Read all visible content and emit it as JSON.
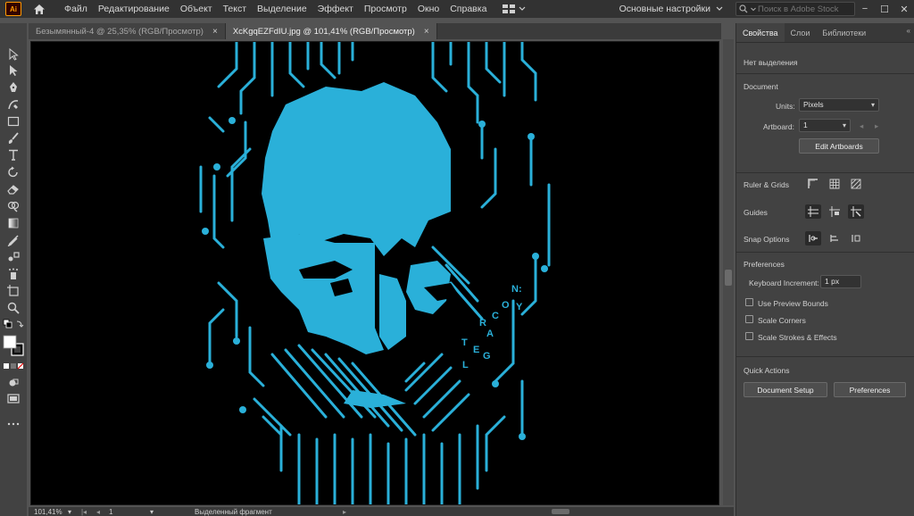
{
  "app": {
    "logo_text": "Ai",
    "menus": [
      "Файл",
      "Редактирование",
      "Объект",
      "Текст",
      "Выделение",
      "Эффект",
      "Просмотр",
      "Окно",
      "Справка"
    ],
    "workspace_label": "Основные настройки",
    "stock_search_placeholder": "Поиск в Adobe Stock",
    "window_controls": [
      "−",
      "☐",
      "✕"
    ]
  },
  "tabs": [
    {
      "label": "Безымянный-4 @ 25,35% (RGB/Просмотр)",
      "close": "×",
      "active": false
    },
    {
      "label": "XcKgqEZFdIU.jpg @ 101,41% (RGB/Просмотр)",
      "close": "×",
      "active": true
    }
  ],
  "artwork_letters": [
    "N:",
    "O",
    "C",
    "Y",
    "R",
    "A",
    "T",
    "E",
    "G",
    "L"
  ],
  "status": {
    "zoom": "101,41%",
    "artboard": "1",
    "state": "Выделенный фрагмент"
  },
  "panel": {
    "tabs": [
      "Свойства",
      "Слои",
      "Библиотеки"
    ],
    "no_selection": "Нет выделения",
    "document_title": "Document",
    "units_label": "Units:",
    "units_value": "Pixels",
    "artboard_label": "Artboard:",
    "artboard_value": "1",
    "edit_artboards": "Edit Artboards",
    "ruler_grids": "Ruler & Grids",
    "guides": "Guides",
    "snap_options": "Snap Options",
    "preferences_title": "Preferences",
    "keyboard_increment_label": "Keyboard Increment:",
    "keyboard_increment_value": "1 px",
    "use_preview_bounds": "Use Preview Bounds",
    "scale_corners": "Scale Corners",
    "scale_strokes": "Scale Strokes & Effects",
    "quick_actions": "Quick Actions",
    "document_setup": "Document Setup",
    "preferences_button": "Preferences"
  },
  "colors": {
    "accent_cyan": "#2ab0d9",
    "app_bg": "#535353",
    "panel_bg": "#424242",
    "menubar_bg": "#323232",
    "artboard_bg": "#000000"
  }
}
